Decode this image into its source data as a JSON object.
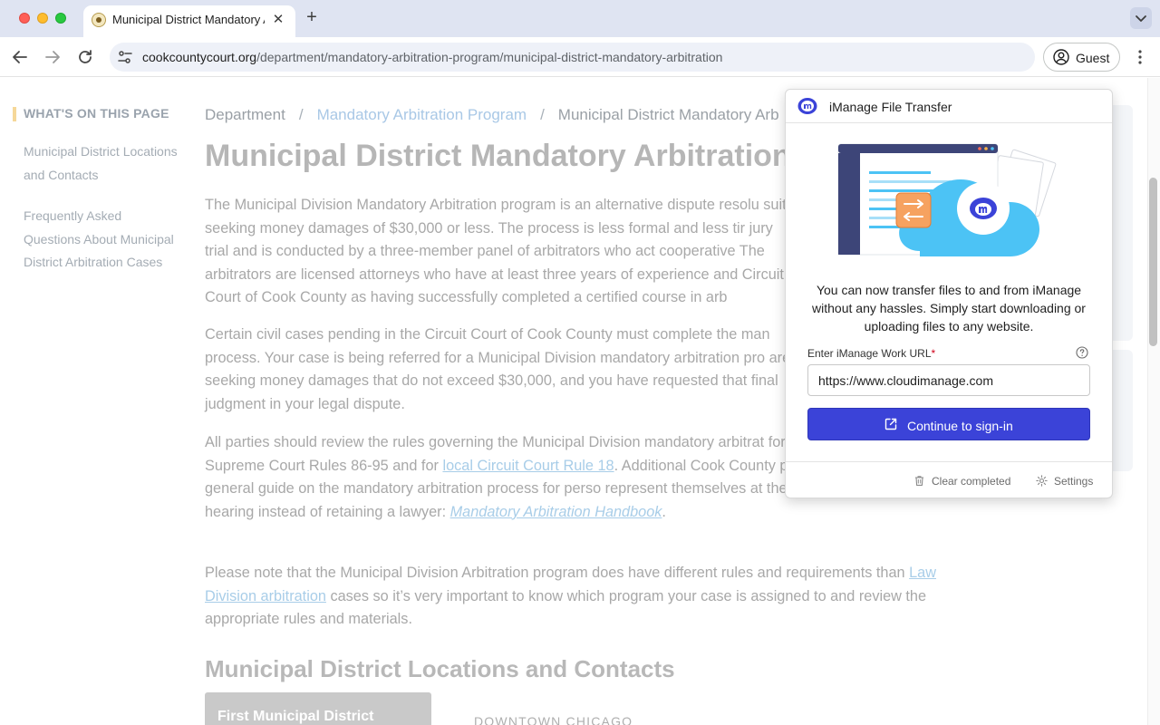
{
  "browser": {
    "tab_title": "Municipal District Mandatory Arbitration",
    "url_host": "cookcountycourt.org",
    "url_path": "/department/mandatory-arbitration-program/municipal-district-mandatory-arbitration",
    "profile_label": "Guest"
  },
  "toc": {
    "heading": "WHAT'S ON THIS PAGE",
    "items": [
      "Municipal District Locations and Contacts",
      "Frequently Asked Questions About Municipal District Arbitration Cases"
    ]
  },
  "breadcrumb": {
    "department": "Department",
    "program": "Mandatory Arbitration Program",
    "current": "Municipal District Mandatory Arb",
    "separator": "/"
  },
  "page_title": "Municipal District Mandatory Arbitration",
  "paragraphs": {
    "p1": "The Municipal Division Mandatory Arbitration program is an alternative dispute resolu suits seeking money damages of $30,000 or less. The process is less formal and less tir jury trial and is conducted by a three-member panel of arbitrators who act cooperative The arbitrators are licensed attorneys who have at least three years of experience and Circuit Court of Cook County as having successfully completed a certified course in arb",
    "p2": "Certain civil cases pending in the Circuit Court of Cook County must complete the man process. Your case is being referred for a Municipal Division mandatory arbitration pro are seeking money damages that do not exceed $30,000, and you have requested that final judgment in your legal dispute.",
    "p3_before": "All parties should review the rules governing the Municipal Division mandatory arbitrat for a copy of Supreme Court Rules 86-95 and for ",
    "p3_link1": "local Circuit Court Rule 18",
    "p3_middle": ". Additional Cook County provides a general guide on the mandatory arbitration process for perso represent themselves at the arbitration hearing instead of retaining a lawyer: ",
    "p3_link2": "Mandatory Arbitration Handbook",
    "p3_after": ".",
    "p4_before": "Please note that the Municipal Division Arbitration program does have different rules and requirements than ",
    "p4_link": "Law Division arbitration",
    "p4_after": " cases so it’s very important to know which program your case is assigned to and review the appropriate rules and materials."
  },
  "locations": {
    "section_title": "Municipal District Locations and Contacts",
    "first_district": "First Municipal District",
    "downtown_label": "DOWNTOWN CHICAGO"
  },
  "popup": {
    "title": "iManage File Transfer",
    "message": "You can now transfer files to and from iManage without any hassles. Simply start downloading or uploading files to any website.",
    "field_label": "Enter iManage Work URL",
    "required_mark": "*",
    "url_value": "https://www.cloudimanage.com",
    "signin_label": "Continue to sign-in",
    "clear_label": "Clear completed",
    "settings_label": "Settings"
  },
  "colors": {
    "brand_blue": "#3b43d8",
    "cloud_blue": "#4cc3f5",
    "link_blue": "#a8cde8",
    "toc_accent": "#f6d899"
  },
  "icons": [
    "back-arrow-icon",
    "forward-arrow-icon",
    "reload-icon",
    "site-info-icon",
    "profile-icon",
    "kebab-menu-icon",
    "imanage-logo-icon",
    "help-icon",
    "external-link-icon",
    "trash-icon",
    "gear-icon"
  ]
}
